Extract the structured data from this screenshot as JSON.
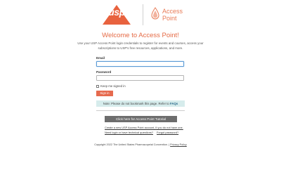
{
  "header": {
    "usp_logo_text": "usp",
    "brand_line1": "Access",
    "brand_line2": "Point",
    "brand_color": "#e87a55"
  },
  "login": {
    "title": "Welcome to Access Point!",
    "subtitle": "Use your USP Access Point login credentials to register for events and courses, access your subscriptions to USP's free resources, applications, and more.",
    "email_label": "Email",
    "email_value": "",
    "password_label": "Password",
    "password_value": "",
    "remember_label": "Keep me signed in",
    "remember_checked": false,
    "signin_label": "Sign in",
    "note_text": "Note: Please do not bookmark this page. Refer to ",
    "note_link": "FAQs",
    "tutorial_label": "Click here for Access Point Tutorial",
    "create_account_link": "Create a new USP Access Point account, if you do not have one.",
    "need_help_link": "Need login or have technical questions?",
    "forgot_password_link": "Forgot password?"
  },
  "footer": {
    "copyright": "Copyright 2022 The United States Pharmacopeial Convention. | ",
    "privacy_link": "Privacy Policy"
  },
  "colors": {
    "accent": "#e66a4e",
    "note_bg": "#d6ecec",
    "tutorial_bg": "#6d6d6d"
  }
}
